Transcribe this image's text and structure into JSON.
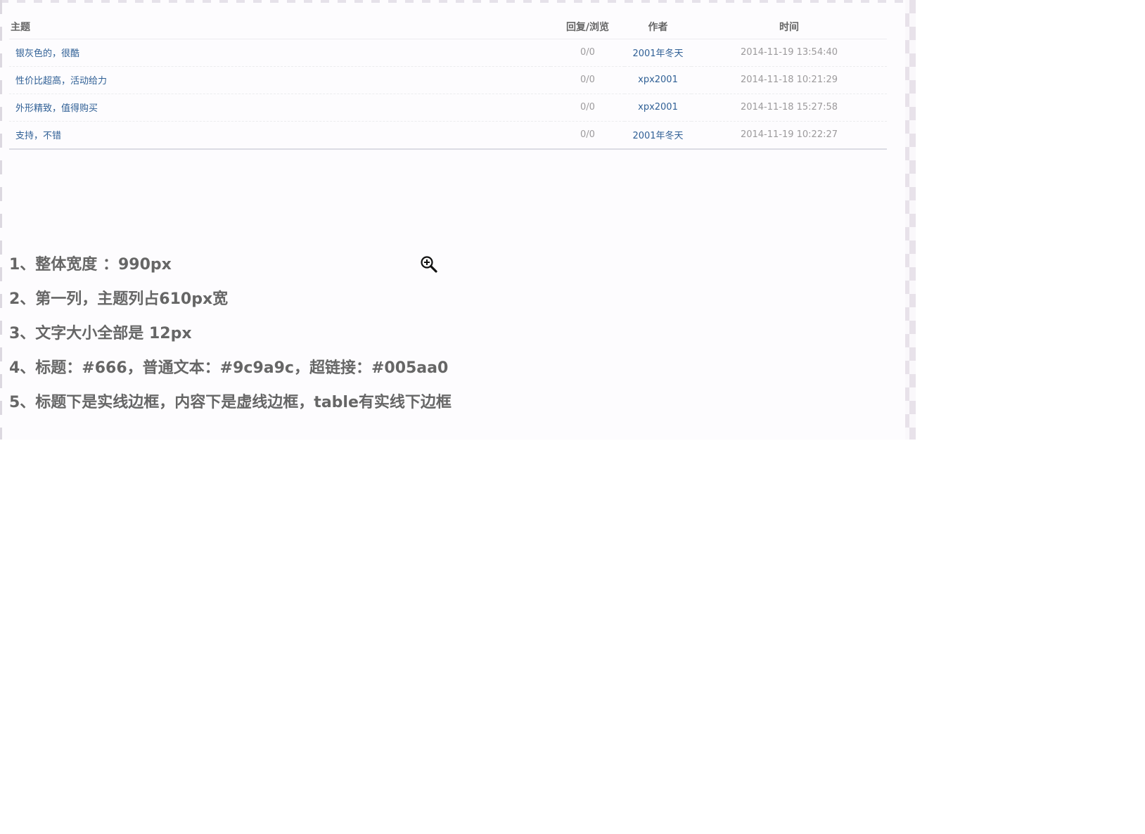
{
  "table": {
    "headers": {
      "topic": "主题",
      "replies": "回复/浏览",
      "author": "作者",
      "time": "时间"
    },
    "rows": [
      {
        "topic": "银灰色的，很酷",
        "replies": "0/0",
        "author": "2001年冬天",
        "time": "2014-11-19 13:54:40"
      },
      {
        "topic": "性价比超高，活动给力",
        "replies": "0/0",
        "author": "xpx2001",
        "time": "2014-11-18 10:21:29"
      },
      {
        "topic": "外形精致，值得购买",
        "replies": "0/0",
        "author": "xpx2001",
        "time": "2014-11-18 15:27:58"
      },
      {
        "topic": "支持，不错",
        "replies": "0/0",
        "author": "2001年冬天",
        "time": "2014-11-19 10:22:27"
      }
    ]
  },
  "notes": [
    "1、整体宽度 ：990px",
    "2、第一列，主题列占610px宽",
    "3、文字大小全部是 12px",
    "4、标题：#666，普通文本：#9c9a9c，超链接：#005aa0",
    "5、标题下是实线边框，内容下是虚线边框，table有实线下边框"
  ],
  "cursor": {
    "icon": "zoom-in-icon"
  },
  "colors": {
    "heading": "#666666",
    "text": "#9c9a9c",
    "link": "#2f5f95"
  }
}
